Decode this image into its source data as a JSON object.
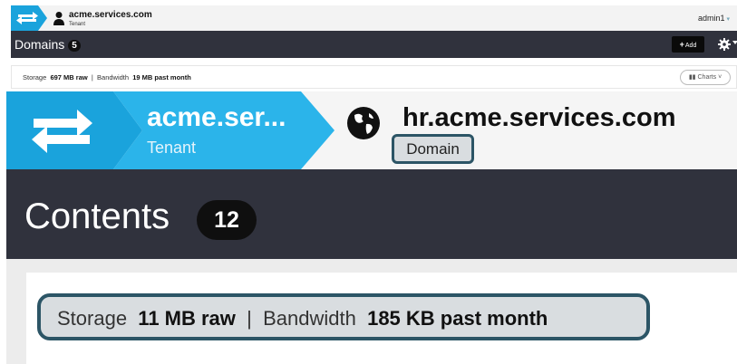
{
  "header": {
    "tenant_name": "acme.services.com",
    "tenant_label": "Tenant",
    "user": "admin1"
  },
  "domains_bar": {
    "title": "Domains",
    "count": "5",
    "add_label": "Add"
  },
  "storage_summary": {
    "storage_label": "Storage",
    "storage_value": "697 MB raw",
    "separator": "|",
    "bandwidth_label": "Bandwidth",
    "bandwidth_value": "19 MB past month",
    "charts_label": "Charts"
  },
  "zoom": {
    "tenant_name": "acme.ser...",
    "tenant_label": "Tenant",
    "domain_name": "hr.acme.services.com",
    "domain_label": "Domain",
    "contents_title": "Contents",
    "contents_count": "12",
    "storage_label": "Storage",
    "storage_value": "11 MB raw",
    "separator": "|",
    "bandwidth_label": "Bandwidth",
    "bandwidth_value": "185 KB past month"
  },
  "colors": {
    "brand_blue": "#1aa3dc",
    "dark_bar": "#30323d",
    "highlight_border": "#2c5566"
  }
}
